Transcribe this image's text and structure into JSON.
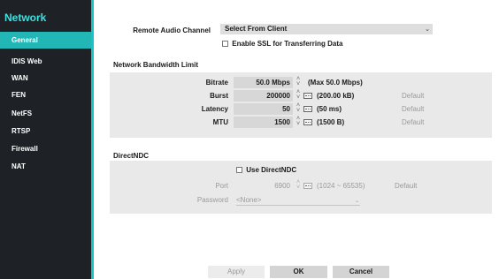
{
  "sidebar": {
    "title": "Network",
    "items": [
      {
        "label": "General",
        "active": true
      },
      {
        "label": "IDIS Web"
      },
      {
        "label": "WAN"
      },
      {
        "label": "FEN"
      },
      {
        "label": "NetFS"
      },
      {
        "label": "RTSP"
      },
      {
        "label": "Firewall"
      },
      {
        "label": "NAT"
      }
    ]
  },
  "remote_audio": {
    "label": "Remote Audio Channel",
    "value": "Select From Client"
  },
  "ssl": {
    "label": "Enable SSL for Transferring Data",
    "checked": false
  },
  "bandwidth": {
    "heading": "Network Bandwidth Limit",
    "rows": [
      {
        "label": "Bitrate",
        "value": "50.0 Mbps",
        "note": "(Max 50.0 Mbps)",
        "default": ""
      },
      {
        "label": "Burst",
        "value": "200000",
        "note": "(200.00 kB)",
        "default": "Default"
      },
      {
        "label": "Latency",
        "value": "50",
        "note": "(50 ms)",
        "default": "Default"
      },
      {
        "label": "MTU",
        "value": "1500",
        "note": "(1500 B)",
        "default": "Default"
      }
    ]
  },
  "directndc": {
    "heading": "DirectNDC",
    "use_label": "Use DirectNDC",
    "use_checked": false,
    "port_label": "Port",
    "port_value": "6900",
    "port_range": "(1024 ~ 65535)",
    "port_default": "Default",
    "password_label": "Password",
    "password_value": "<None>"
  },
  "buttons": {
    "apply": "Apply",
    "ok": "OK",
    "cancel": "Cancel"
  },
  "colors": {
    "accent": "#22b6b6",
    "sidebar_bg": "#1e2226",
    "title": "#3ee0e0"
  },
  "icons": [
    "spinner-icon",
    "keyboard-icon",
    "dropdown-arrow-icon",
    "checkbox-icon"
  ]
}
